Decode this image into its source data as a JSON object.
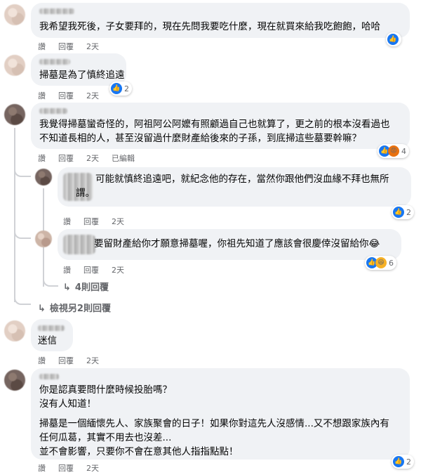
{
  "comments": [
    {
      "text": [
        "我希望我死後，子女要拜的，現在先問我要吃什麼，現在就買來給我吃飽飽，哈哈"
      ],
      "actions": {
        "like": "讚",
        "reply": "回覆",
        "time": "2天"
      },
      "reactions": {
        "icons": [
          "like"
        ],
        "count": ""
      }
    },
    {
      "text": [
        "掃墓是為了慎終追遠"
      ],
      "actions": {
        "like": "讚",
        "reply": "回覆",
        "time": "2天"
      },
      "reactions": {
        "icons": [
          "like"
        ],
        "count": "2"
      }
    },
    {
      "text": [
        "我覺得掃墓蠻奇怪的，阿祖阿公阿嬤有照顧過自己也就算了，更之前的根本沒看過也",
        "不知道長相的人，甚至沒留過什麼財產給後來的子孫，到底掃這些墓要幹嘛？"
      ],
      "actions": {
        "like": "讚",
        "reply": "回覆",
        "time": "2天",
        "edited": "已編輯"
      },
      "reactions": {
        "icons": [
          "like",
          "angry"
        ],
        "count": "4"
      }
    },
    {
      "text": [
        "可能就慎終追遠吧，就紀念他的存在，當然你跟他們沒血緣不拜也無所",
        "謂。"
      ],
      "actions": {
        "like": "讚",
        "reply": "回覆",
        "time": "2天"
      },
      "reactions": {
        "icons": [
          "like"
        ],
        "count": "2"
      }
    },
    {
      "text": [
        "要留財產給你才願意掃墓喔，你祖先知道了應該會很慶倖沒留給你😂"
      ],
      "actions": {
        "like": "讚",
        "reply": "回覆",
        "time": "2天"
      },
      "reactions": {
        "icons": [
          "like",
          "haha"
        ],
        "count": "6"
      }
    },
    {
      "text": [
        "迷信"
      ],
      "actions": {
        "like": "讚",
        "reply": "回覆",
        "time": "2天"
      },
      "reactions": {
        "icons": [],
        "count": ""
      }
    },
    {
      "text": [
        "你是認真要問什麼時候投胎嗎？",
        "沒有人知道！",
        "",
        "掃墓是一個緬懷先人、家族聚會的日子！如果你對這先人沒感情...又不想跟家族內有",
        "任何瓜葛，其實不用去也沒差...",
        "並不會影響，只要你不會在意其他人指指點點！"
      ],
      "actions": {
        "like": "讚",
        "reply": "回覆",
        "time": "2天"
      },
      "reactions": {
        "icons": [
          "like"
        ],
        "count": "2"
      }
    }
  ],
  "more_replies_nested": "4則回覆",
  "more_replies_view": "檢視另2則回覆",
  "icons": {
    "like": "thumbs-up-icon",
    "haha": "laugh-icon",
    "angry": "angry-icon",
    "reply_arrow": "reply-arrow-icon"
  },
  "colors": {
    "like_blue": "#1877f2",
    "bubble_bg": "#f0f2f5",
    "meta_gray": "#65676b"
  }
}
